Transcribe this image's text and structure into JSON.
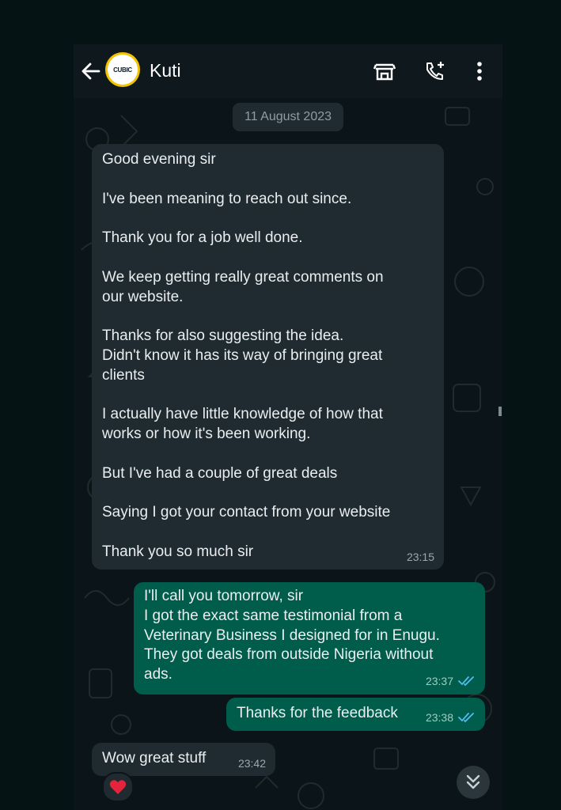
{
  "header": {
    "contact_name": "Kuti",
    "avatar_text": "CUBIC"
  },
  "chat": {
    "date_chip": "11 August 2023",
    "messages": [
      {
        "direction": "incoming",
        "lines": [
          "Good evening sir",
          "",
          "I've been meaning to reach out since.",
          "",
          "Thank you for a job well done.",
          "",
          "We keep getting really great comments on",
          "our website.",
          "",
          "Thanks for also suggesting the idea.",
          "Didn't know it has its way of bringing great",
          "clients",
          "",
          "I actually have little knowledge of how that",
          "works or how it's been working.",
          "",
          "But I've had a couple of great deals",
          "",
          "Saying I got your contact from your website",
          "",
          "Thank you so much sir"
        ],
        "time": "23:15"
      },
      {
        "direction": "outgoing",
        "lines": [
          "I'll call you tomorrow, sir",
          "I got the exact same testimonial from a",
          "Veterinary Business I designed for in Enugu.",
          "They got deals from outside Nigeria without",
          "ads."
        ],
        "time": "23:37",
        "status": "read"
      },
      {
        "direction": "outgoing",
        "lines": [
          "Thanks for the feedback"
        ],
        "time": "23:38",
        "status": "read"
      },
      {
        "direction": "incoming",
        "lines": [
          "Wow great stuff"
        ],
        "time": "23:42",
        "reaction": "❤️"
      }
    ]
  },
  "colors": {
    "incoming_bubble": "#1f2b30",
    "outgoing_bubble": "#005c4b",
    "read_ticks": "#53bdeb",
    "avatar_ring": "#f5c400"
  },
  "icons": [
    "back-arrow-icon",
    "store-icon",
    "add-call-icon",
    "more-vert-icon",
    "double-check-icon",
    "heart-icon",
    "double-chevron-down-icon"
  ]
}
